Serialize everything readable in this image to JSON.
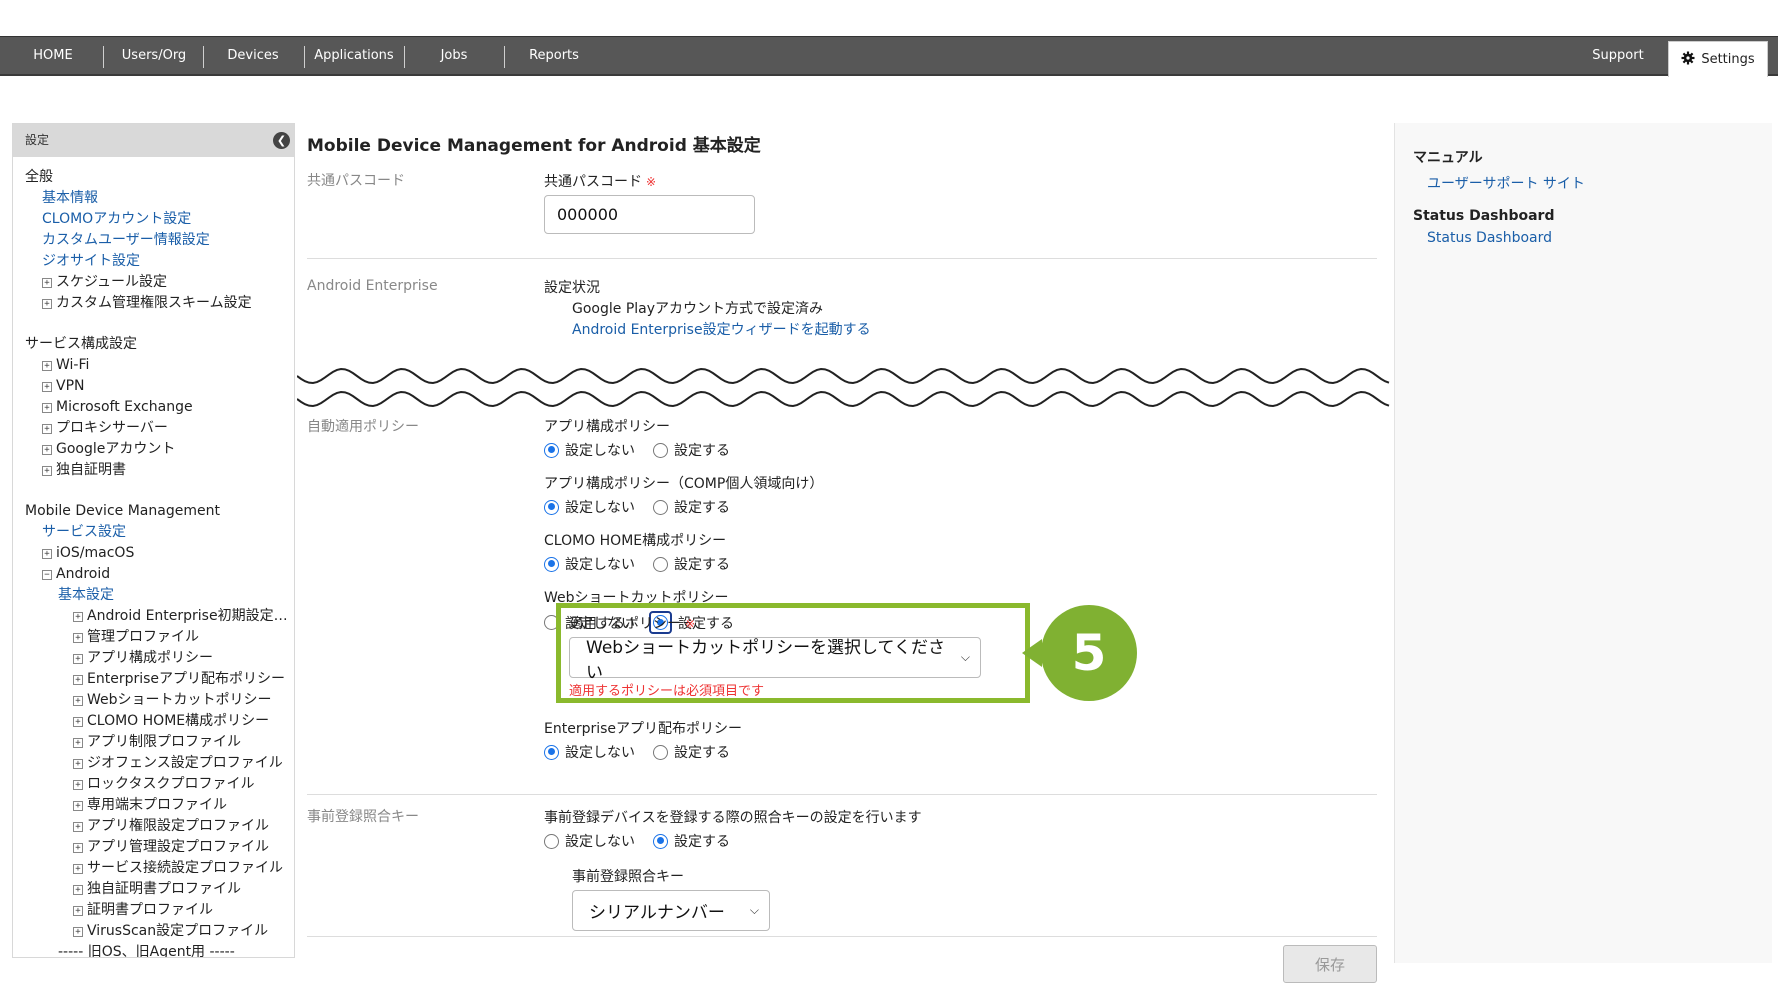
{
  "nav": {
    "items": [
      "HOME",
      "Users/Org",
      "Devices",
      "Applications",
      "Jobs",
      "Reports"
    ],
    "support": "Support",
    "settings": "Settings"
  },
  "sidebar": {
    "header": "設定",
    "general_title": "全般",
    "general_links": [
      "基本情報",
      "CLOMOアカウント設定",
      "カスタムユーザー情報設定",
      "ジオサイト設定"
    ],
    "general_expanders": [
      "スケジュール設定",
      "カスタム管理権限スキーム設定"
    ],
    "service_title": "サービス構成設定",
    "service_items": [
      "Wi-Fi",
      "VPN",
      "Microsoft Exchange",
      "プロキシサーバー",
      "Googleアカウント",
      "独自証明書"
    ],
    "mdm_title": "Mobile Device Management",
    "mdm_link": "サービス設定",
    "ios": "iOS/macOS",
    "android": "Android",
    "android_link": "基本設定",
    "android_items": [
      "Android Enterprise初期設定…",
      "管理プロファイル",
      "アプリ構成ポリシー",
      "Enterpriseアプリ配布ポリシー",
      "Webショートカットポリシー",
      "CLOMO HOME構成ポリシー",
      "アプリ制限プロファイル",
      "ジオフェンス設定プロファイル",
      "ロックタスクプロファイル",
      "専用端末プロファイル",
      "アプリ権限設定プロファイル",
      "アプリ管理設定プロファイル",
      "サービス接続設定プロファイル",
      "独自証明書プロファイル",
      "証明書プロファイル",
      "VirusScan設定プロファイル"
    ],
    "legacy": "----- 旧OS、旧Agent用 -----"
  },
  "main": {
    "title": "Mobile Device Management for Android 基本設定",
    "passcode": {
      "section": "共通パスコード",
      "label": "共通パスコード",
      "required_mark": "※",
      "value": "000000"
    },
    "enterprise": {
      "section": "Android Enterprise",
      "status_label": "設定状況",
      "status_value": "Google Playアカウント方式で設定済み",
      "wizard_link": "Android Enterprise設定ウィザードを起動する"
    },
    "auto_policy": {
      "section": "自動適用ポリシー",
      "off": "設定しない",
      "on": "設定する",
      "app_config": "アプリ構成ポリシー",
      "app_config_comp": "アプリ構成ポリシー（COMP個人領域向け）",
      "clomo_home": "CLOMO HOME構成ポリシー",
      "web_shortcut": "Webショートカットポリシー",
      "apply_label": "適用するポリシー",
      "required_mark": "※",
      "apply_placeholder": "Webショートカットポリシーを選択してください",
      "apply_error": "適用するポリシーは必須項目です",
      "enterprise_app": "Enterpriseアプリ配布ポリシー"
    },
    "prereg": {
      "section": "事前登録照合キー",
      "description": "事前登録デバイスを登録する際の照合キーの設定を行います",
      "off": "設定しない",
      "on": "設定する",
      "key_label": "事前登録照合キー",
      "key_value": "シリアルナンバー"
    },
    "save": "保存",
    "callout_number": "5"
  },
  "right": {
    "manual_title": "マニュアル",
    "manual_link": "ユーザーサポート サイト",
    "status_title": "Status Dashboard",
    "status_link": "Status Dashboard"
  },
  "colors": {
    "nav_bg": "#575757",
    "link": "#1a5ea8",
    "highlight": "#8ab92d",
    "error": "#e33333"
  }
}
